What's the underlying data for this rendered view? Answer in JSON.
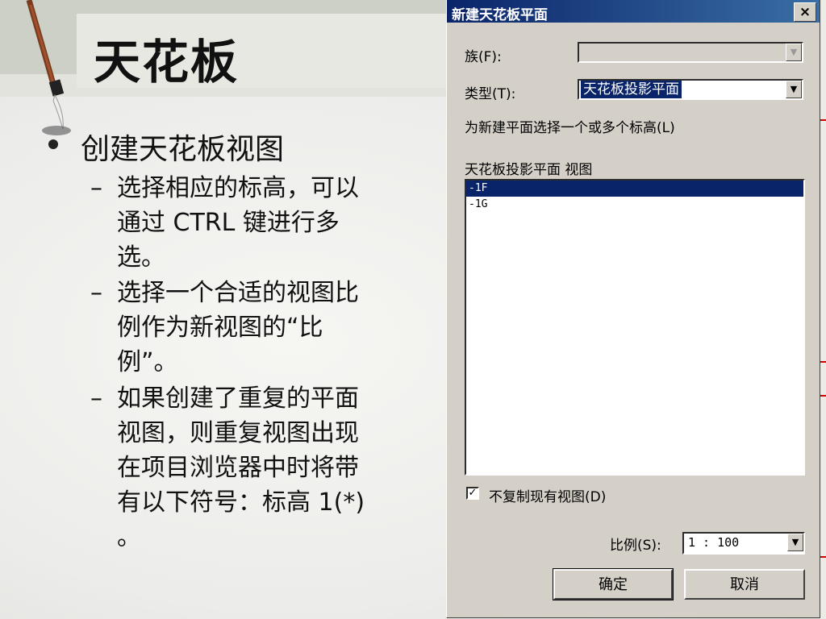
{
  "slide": {
    "title": "天花板",
    "bullet": "创建天花板视图",
    "subbullets": [
      "选择相应的标高，可以通过 CTRL 键进行多选。",
      "选择一个合适的视图比例作为新视图的“比例”。",
      "如果创建了重复的平面视图，则重复视图出现在项目浏览器中时将带有以下符号：标高  1(*) 。"
    ],
    "dash": "–"
  },
  "dialog": {
    "title": "新建天花板平面",
    "close_label": "×",
    "family_label": "族(F):",
    "family_value": "",
    "type_label": "类型(T):",
    "type_value": "天花板投影平面",
    "select_levels_label": "为新建平面选择一个或多个标高(L)",
    "list_header": "天花板投影平面 视图",
    "levels": [
      "-1F",
      "-1G"
    ],
    "no_duplicate_label": "不复制现有视图(D)",
    "no_duplicate_checked": "✓",
    "scale_label": "比例(S):",
    "scale_value": "1 : 100",
    "ok_label": "确定",
    "cancel_label": "取消",
    "dropdown_arrow": "▼"
  }
}
